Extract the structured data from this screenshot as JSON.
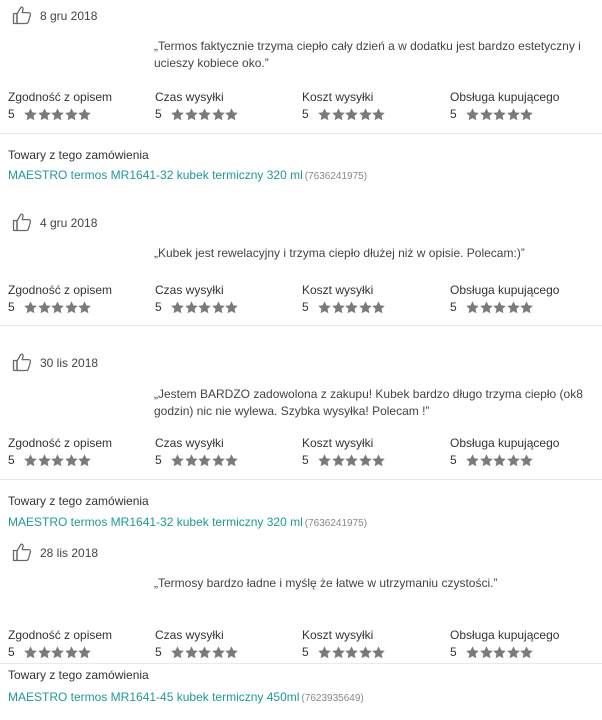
{
  "rating_labels": [
    "Zgodność z opisem",
    "Czas wysyłki",
    "Koszt wysyłki",
    "Obsługa kupującego"
  ],
  "colors": {
    "link": "#1d9a97",
    "star": "#7a7a7a",
    "separator": "#e9e9e9"
  },
  "reviews": [
    {
      "date": "8 gru 2018",
      "comment": "„Termos faktycznie trzyma ciepło cały dzień a w dodatku jest bardzo estetyczny i ucieszy kobiece oko.”",
      "scores": [
        "5",
        "5",
        "5",
        "5"
      ],
      "stars": 5,
      "order_title": "Towary z tego zamówienia",
      "product": "MAESTRO termos MR1641-32 kubek termiczny 320 ml",
      "product_id": "(7636241975)"
    },
    {
      "date": "4 gru 2018",
      "comment": "„Kubek jest rewelacyjny i trzyma ciepło dłużej niż w opisie. Polecam:)”",
      "scores": [
        "5",
        "5",
        "5",
        "5"
      ],
      "stars": 5
    },
    {
      "date": "30 lis 2018",
      "comment": "„Jestem BARDZO zadowolona z zakupu! Kubek bardzo długo trzyma ciepło (ok8 godzin) nic nie wylewa. Szybka wysyłka! Polecam !”",
      "scores": [
        "5",
        "5",
        "5",
        "5"
      ],
      "stars": 5,
      "order_title": "Towary z tego zamówienia",
      "product": "MAESTRO termos MR1641-32 kubek termiczny 320 ml",
      "product_id": "(7636241975)"
    },
    {
      "date": "28 lis 2018",
      "comment": "„Termosy bardzo ładne i myślę że łatwe w utrzymaniu czystości.”",
      "scores": [
        "5",
        "5",
        "5",
        "5"
      ],
      "stars": 5,
      "order_title": "Towary z tego zamówienia",
      "product": "MAESTRO termos MR1641-45 kubek termiczny 450ml",
      "product_id": "(7623935649)"
    }
  ]
}
